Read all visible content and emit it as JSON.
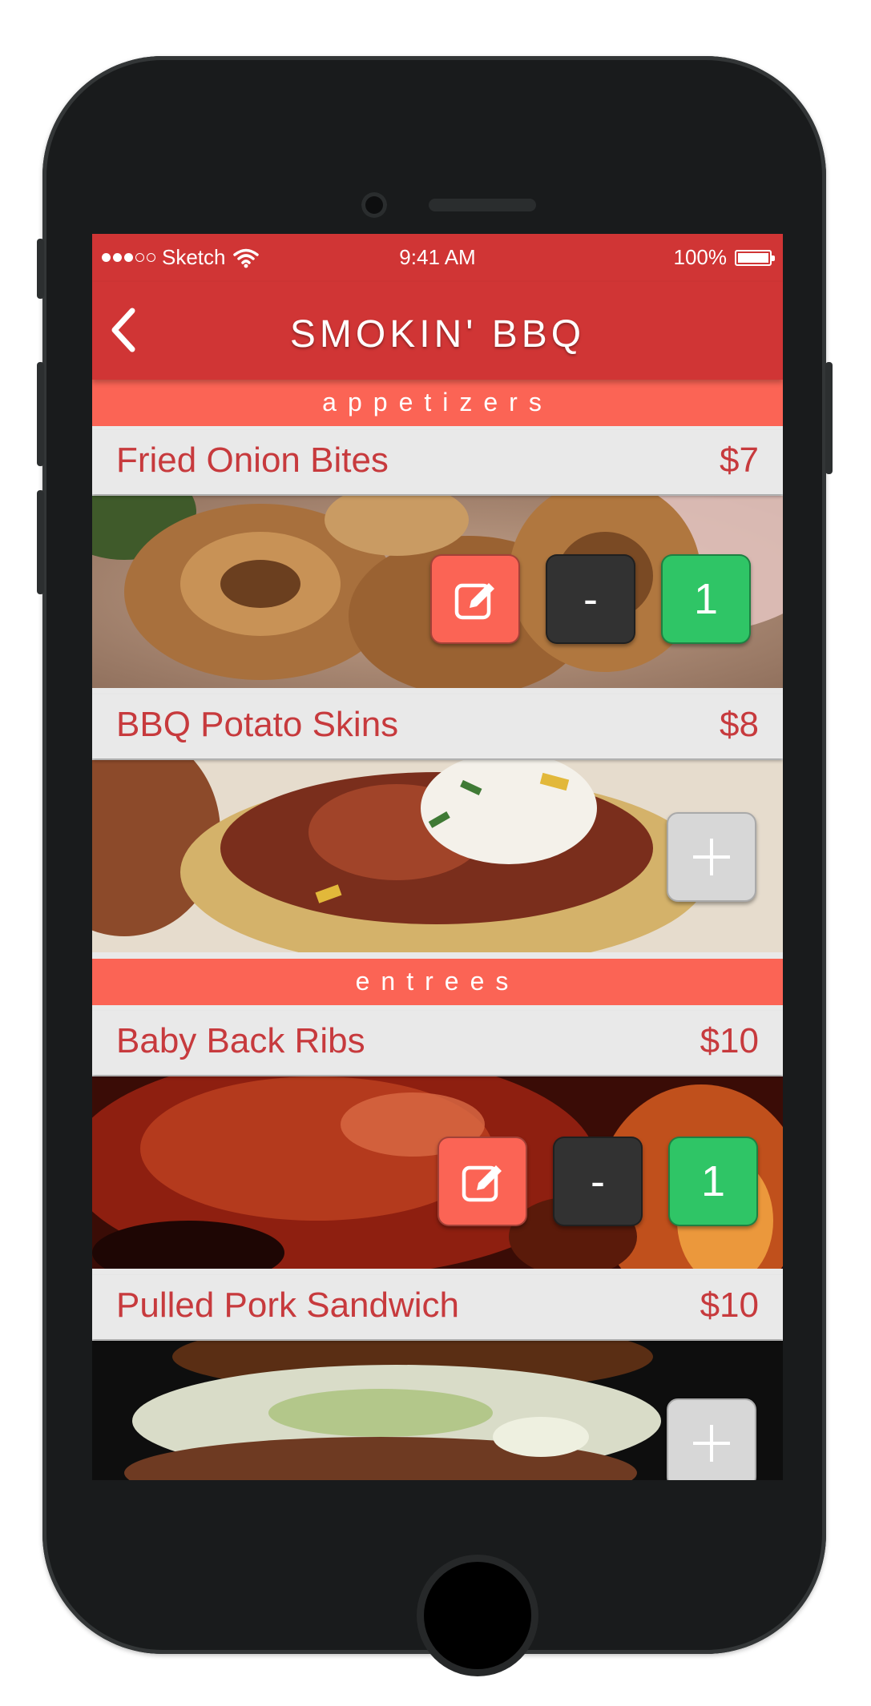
{
  "status_bar": {
    "carrier": "Sketch",
    "time": "9:41 AM",
    "battery": "100%"
  },
  "nav": {
    "title": "SMOKIN' BBQ"
  },
  "sections": [
    {
      "label": "appetizers",
      "items": [
        {
          "name": "Fried Onion Bites",
          "price": "$7",
          "qty": "1"
        },
        {
          "name": "BBQ Potato Skins",
          "price": "$8"
        }
      ]
    },
    {
      "label": "entrees",
      "items": [
        {
          "name": "Baby Back Ribs",
          "price": "$10",
          "qty": "1"
        },
        {
          "name": "Pulled Pork Sandwich",
          "price": "$10"
        }
      ]
    }
  ],
  "buttons": {
    "minus_label": "-"
  },
  "icons": {
    "back": "chevron-left-icon",
    "edit": "pencil-square-icon",
    "add": "plus-icon",
    "wifi": "wifi-icon",
    "battery": "battery-icon"
  },
  "colors": {
    "nav": "#d03535",
    "section": "#fb6455",
    "text": "#c73a3d",
    "qty": "#2fc566",
    "minus": "#323232",
    "add": "#d7d7d7"
  }
}
